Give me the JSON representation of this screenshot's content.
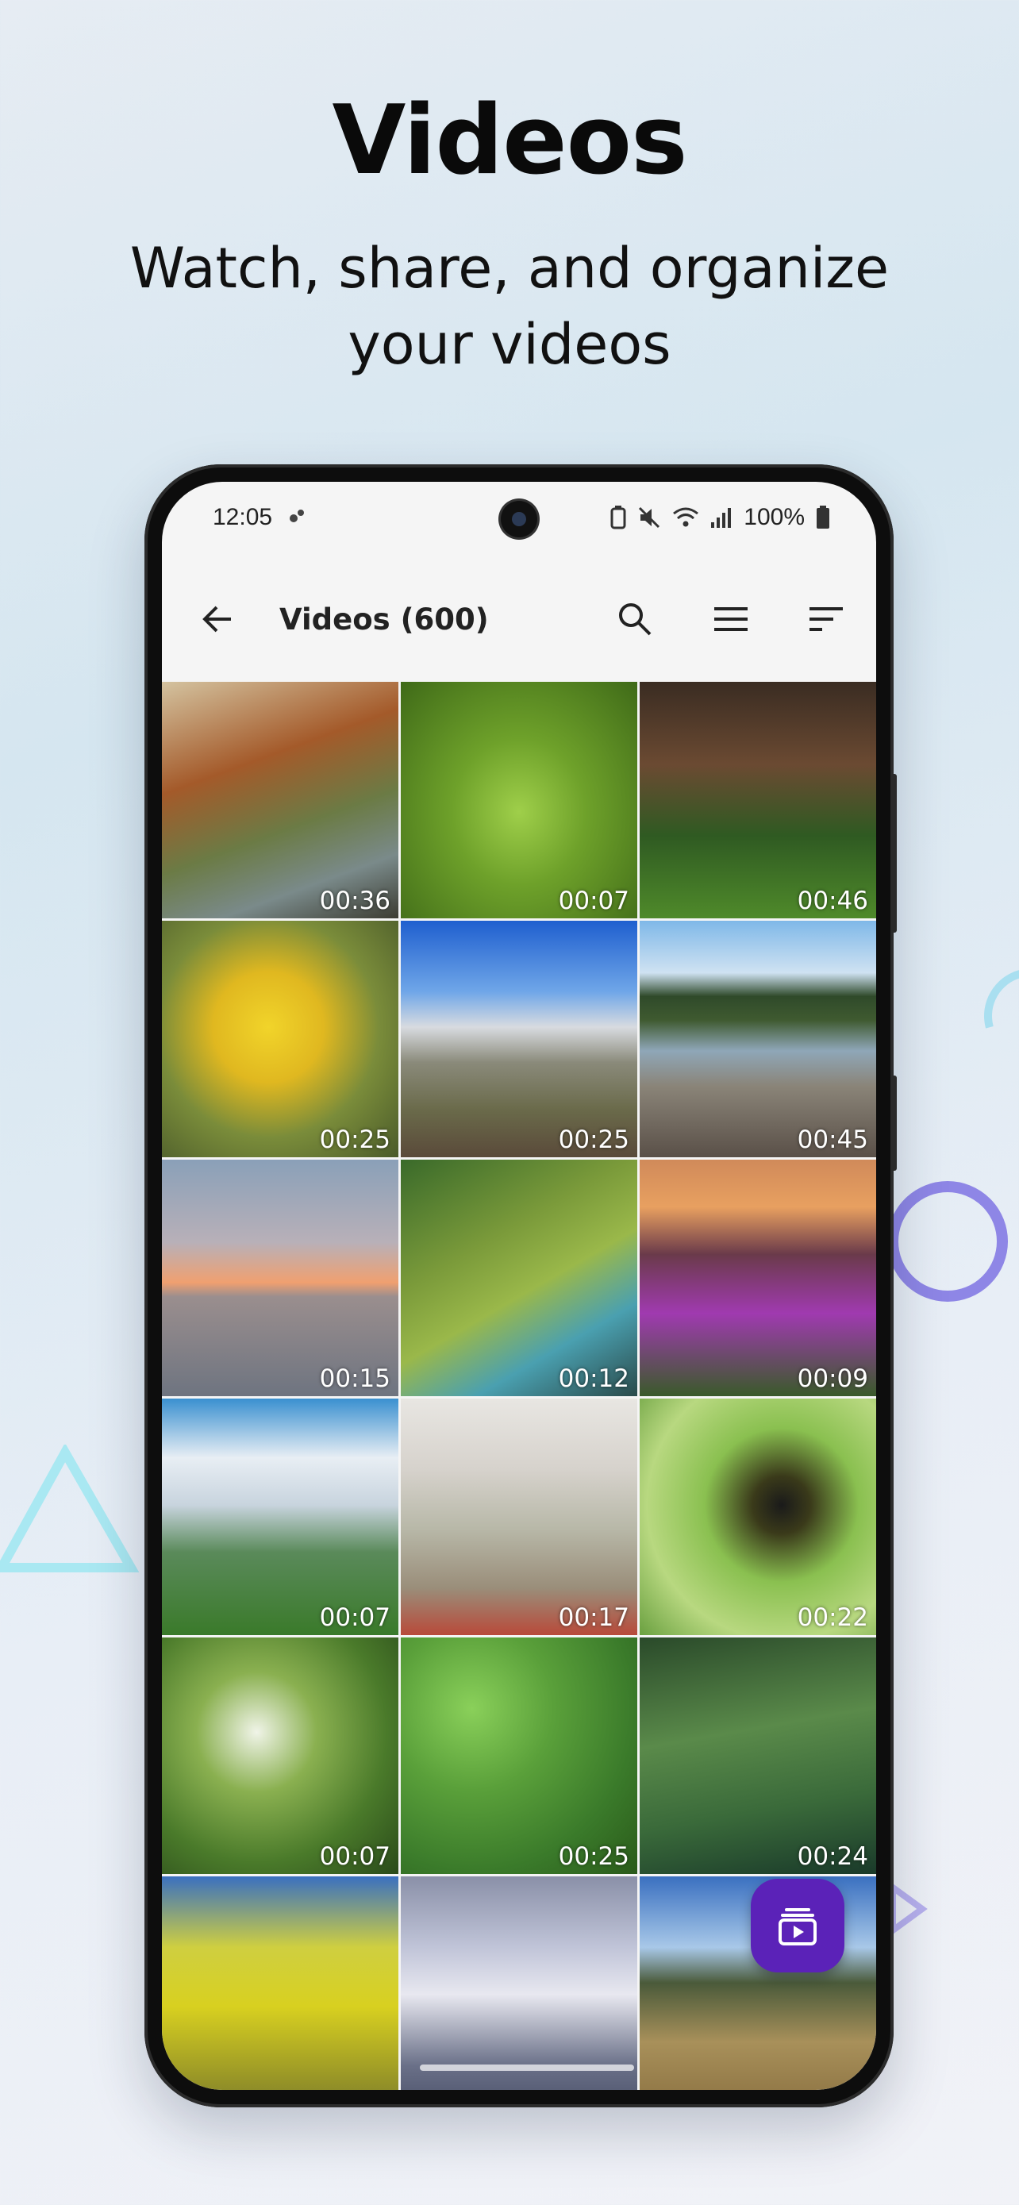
{
  "promo": {
    "title": "Videos",
    "subtitle": "Watch, share, and organize\nyour videos"
  },
  "status_bar": {
    "time": "12:05",
    "battery": "100%"
  },
  "app_bar": {
    "title": "Videos (600)",
    "icons": [
      "back-arrow-icon",
      "search-icon",
      "list-view-icon",
      "sort-icon"
    ]
  },
  "videos": [
    {
      "duration": "00:36",
      "theme": "autumn-river"
    },
    {
      "duration": "00:07",
      "theme": "green-fern"
    },
    {
      "duration": "00:46",
      "theme": "mushrooms"
    },
    {
      "duration": "00:25",
      "theme": "yellow-flowers"
    },
    {
      "duration": "00:25",
      "theme": "mountain-peak"
    },
    {
      "duration": "00:45",
      "theme": "river-stones"
    },
    {
      "duration": "00:15",
      "theme": "sunset-sea"
    },
    {
      "duration": "00:12",
      "theme": "mossy-log"
    },
    {
      "duration": "00:09",
      "theme": "purple-flowers"
    },
    {
      "duration": "00:07",
      "theme": "valley-clouds"
    },
    {
      "duration": "00:17",
      "theme": "poppies"
    },
    {
      "duration": "00:22",
      "theme": "toucan"
    },
    {
      "duration": "00:07",
      "theme": "leaves"
    },
    {
      "duration": "00:25",
      "theme": "forest-aerial"
    },
    {
      "duration": "00:24",
      "theme": "anemone"
    },
    {
      "duration": "",
      "theme": "yellow-bush"
    },
    {
      "duration": "",
      "theme": "swans"
    },
    {
      "duration": "",
      "theme": "meadow"
    }
  ],
  "fab": {
    "icon": "video-library-icon"
  },
  "colors": {
    "accent": "#5b22b8",
    "ring": "#8e86e6",
    "triangle": "#a9e8f2"
  }
}
